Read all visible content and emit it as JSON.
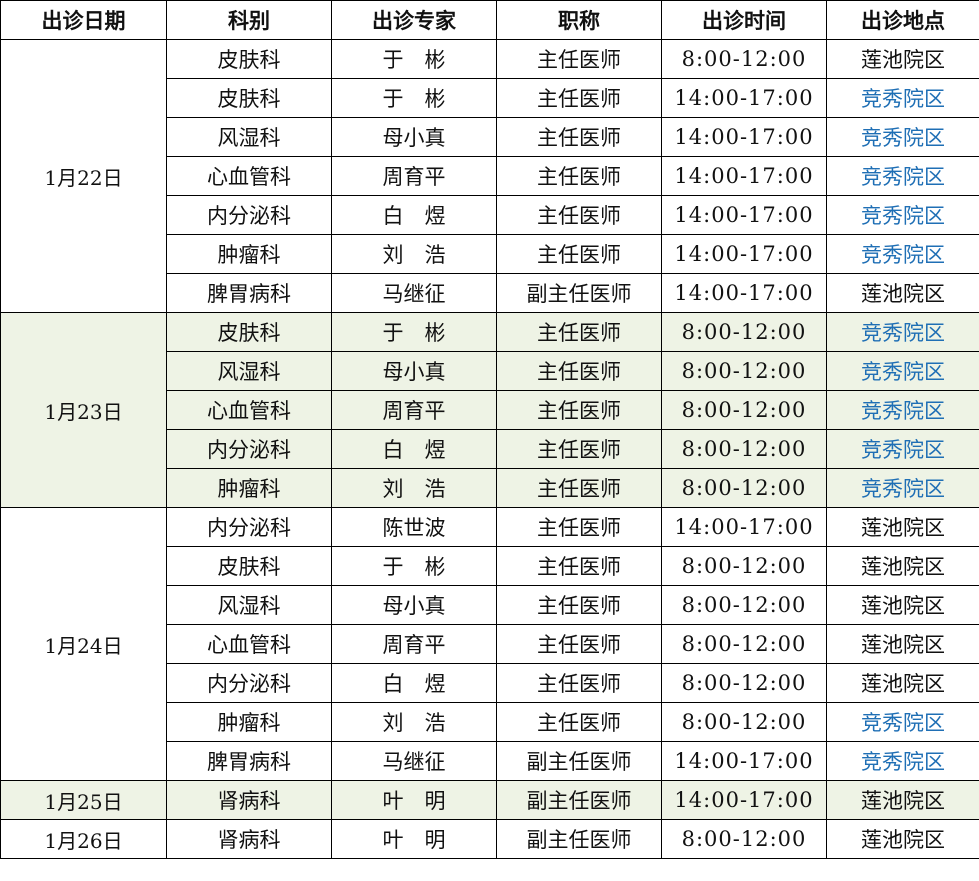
{
  "headers": [
    "出诊日期",
    "科别",
    "出诊专家",
    "职称",
    "出诊时间",
    "出诊地点"
  ],
  "colors": {
    "shaded_row_bg": "#eef3e5",
    "blue_location": "#1f6fb5",
    "border": "#000000"
  },
  "groups": [
    {
      "date": "1月22日",
      "shaded": false,
      "rows": [
        {
          "dept": "皮肤科",
          "doctor": "于　彬",
          "title": "主任医师",
          "time": "8:00-12:00",
          "location": "莲池院区",
          "location_blue": false
        },
        {
          "dept": "皮肤科",
          "doctor": "于　彬",
          "title": "主任医师",
          "time": "14:00-17:00",
          "location": "竞秀院区",
          "location_blue": true
        },
        {
          "dept": "风湿科",
          "doctor": "母小真",
          "title": "主任医师",
          "time": "14:00-17:00",
          "location": "竞秀院区",
          "location_blue": true
        },
        {
          "dept": "心血管科",
          "doctor": "周育平",
          "title": "主任医师",
          "time": "14:00-17:00",
          "location": "竞秀院区",
          "location_blue": true
        },
        {
          "dept": "内分泌科",
          "doctor": "白　煜",
          "title": "主任医师",
          "time": "14:00-17:00",
          "location": "竞秀院区",
          "location_blue": true
        },
        {
          "dept": "肿瘤科",
          "doctor": "刘　浩",
          "title": "主任医师",
          "time": "14:00-17:00",
          "location": "竞秀院区",
          "location_blue": true
        },
        {
          "dept": "脾胃病科",
          "doctor": "马继征",
          "title": "副主任医师",
          "time": "14:00-17:00",
          "location": "莲池院区",
          "location_blue": false
        }
      ]
    },
    {
      "date": "1月23日",
      "shaded": true,
      "rows": [
        {
          "dept": "皮肤科",
          "doctor": "于　彬",
          "title": "主任医师",
          "time": "8:00-12:00",
          "location": "竞秀院区",
          "location_blue": true
        },
        {
          "dept": "风湿科",
          "doctor": "母小真",
          "title": "主任医师",
          "time": "8:00-12:00",
          "location": "竞秀院区",
          "location_blue": true
        },
        {
          "dept": "心血管科",
          "doctor": "周育平",
          "title": "主任医师",
          "time": "8:00-12:00",
          "location": "竞秀院区",
          "location_blue": true
        },
        {
          "dept": "内分泌科",
          "doctor": "白　煜",
          "title": "主任医师",
          "time": "8:00-12:00",
          "location": "竞秀院区",
          "location_blue": true
        },
        {
          "dept": "肿瘤科",
          "doctor": "刘　浩",
          "title": "主任医师",
          "time": "8:00-12:00",
          "location": "竞秀院区",
          "location_blue": true
        }
      ]
    },
    {
      "date": "1月24日",
      "shaded": false,
      "rows": [
        {
          "dept": "内分泌科",
          "doctor": "陈世波",
          "title": "主任医师",
          "time": "14:00-17:00",
          "location": "莲池院区",
          "location_blue": false
        },
        {
          "dept": "皮肤科",
          "doctor": "于　彬",
          "title": "主任医师",
          "time": "8:00-12:00",
          "location": "莲池院区",
          "location_blue": false
        },
        {
          "dept": "风湿科",
          "doctor": "母小真",
          "title": "主任医师",
          "time": "8:00-12:00",
          "location": "莲池院区",
          "location_blue": false
        },
        {
          "dept": "心血管科",
          "doctor": "周育平",
          "title": "主任医师",
          "time": "8:00-12:00",
          "location": "莲池院区",
          "location_blue": false
        },
        {
          "dept": "内分泌科",
          "doctor": "白　煜",
          "title": "主任医师",
          "time": "8:00-12:00",
          "location": "莲池院区",
          "location_blue": false
        },
        {
          "dept": "肿瘤科",
          "doctor": "刘　浩",
          "title": "主任医师",
          "time": "8:00-12:00",
          "location": "竞秀院区",
          "location_blue": true
        },
        {
          "dept": "脾胃病科",
          "doctor": "马继征",
          "title": "副主任医师",
          "time": "14:00-17:00",
          "location": "竞秀院区",
          "location_blue": true
        }
      ]
    },
    {
      "date": "1月25日",
      "shaded": true,
      "rows": [
        {
          "dept": "肾病科",
          "doctor": "叶　明",
          "title": "副主任医师",
          "time": "14:00-17:00",
          "location": "莲池院区",
          "location_blue": false
        }
      ]
    },
    {
      "date": "1月26日",
      "shaded": false,
      "rows": [
        {
          "dept": "肾病科",
          "doctor": "叶　明",
          "title": "副主任医师",
          "time": "8:00-12:00",
          "location": "莲池院区",
          "location_blue": false
        }
      ]
    }
  ]
}
